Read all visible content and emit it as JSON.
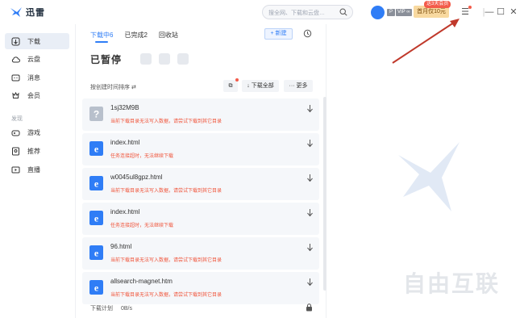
{
  "app": {
    "title": "迅雷"
  },
  "titlebar": {
    "search_placeholder": "搜全网、下载和云盘…",
    "badge_p": "P",
    "badge_vip": "VIP ∞",
    "vip_button": "首月仅10元",
    "vip_tag": "送3天会员"
  },
  "sidebar": {
    "items": [
      {
        "label": "下载",
        "icon": "download-icon",
        "active": true
      },
      {
        "label": "云盘",
        "icon": "cloud-icon",
        "active": false
      },
      {
        "label": "消息",
        "icon": "message-icon",
        "active": false
      },
      {
        "label": "会员",
        "icon": "member-icon",
        "active": false
      }
    ],
    "section_label": "发现",
    "discover_items": [
      {
        "label": "游戏",
        "icon": "game-icon"
      },
      {
        "label": "推荐",
        "icon": "recommend-icon"
      },
      {
        "label": "直播",
        "icon": "live-icon"
      }
    ]
  },
  "main": {
    "tabs": [
      {
        "label": "下载中6",
        "active": true
      },
      {
        "label": "已完成2",
        "active": false
      },
      {
        "label": "回收站",
        "active": false
      }
    ],
    "new_button": "+ 新建",
    "section_title": "已暂停",
    "sort_label": "按创建时间排序 ⇄",
    "download_all": "下载全部",
    "more": "··· 更多",
    "items": [
      {
        "name": "1sj32M9B",
        "error": "当前下载目录无法写入数据，请尝试下载到其它目录",
        "type": "unknown"
      },
      {
        "name": "index.html",
        "error": "任务连接超时，无法继续下载",
        "type": "html"
      },
      {
        "name": "w0045ul8gpz.html",
        "error": "当前下载目录无法写入数据，请尝试下载到其它目录",
        "type": "html"
      },
      {
        "name": "index.html",
        "error": "任务连接超时，无法继续下载",
        "type": "html"
      },
      {
        "name": "96.html",
        "error": "当前下载目录无法写入数据，请尝试下载到其它目录",
        "type": "html"
      },
      {
        "name": "allsearch-magnet.htm",
        "error": "当前下载目录无法写入数据，请尝试下载到其它目录",
        "type": "html"
      }
    ],
    "bottom_label": "下载计划",
    "bottom_speed": "0B/s"
  },
  "watermark": {
    "main": "自由互联",
    "sub": ""
  },
  "colors": {
    "accent": "#2f7df6",
    "error": "#f0553b",
    "annotation": "#c0392b"
  }
}
